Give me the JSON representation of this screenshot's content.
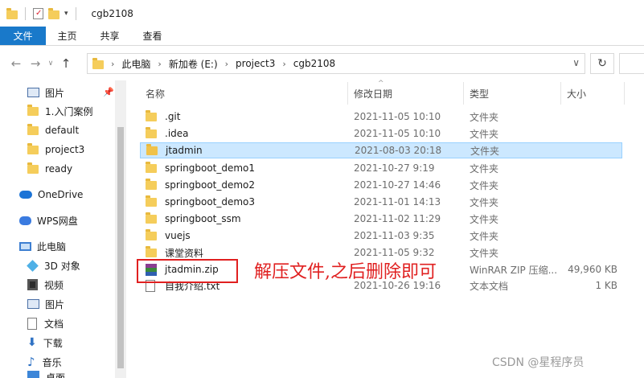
{
  "window": {
    "title": "cgb2108"
  },
  "ribbon": {
    "tabs": [
      "文件",
      "主页",
      "共享",
      "查看"
    ]
  },
  "address": {
    "crumbs": [
      "此电脑",
      "新加卷 (E:)",
      "project3",
      "cgb2108"
    ]
  },
  "nav": {
    "items": [
      {
        "label": "图片",
        "icon": "picture-icon"
      },
      {
        "label": "1.入门案例",
        "icon": "folder-icon"
      },
      {
        "label": "default",
        "icon": "folder-icon"
      },
      {
        "label": "project3",
        "icon": "folder-icon"
      },
      {
        "label": "ready",
        "icon": "folder-icon"
      },
      {
        "label": "OneDrive",
        "icon": "onedrive-icon"
      },
      {
        "label": "WPS网盘",
        "icon": "wps-cloud-icon"
      },
      {
        "label": "此电脑",
        "icon": "this-pc-icon"
      },
      {
        "label": "3D 对象",
        "icon": "3d-objects-icon"
      },
      {
        "label": "视频",
        "icon": "video-icon"
      },
      {
        "label": "图片",
        "icon": "picture-icon"
      },
      {
        "label": "文档",
        "icon": "document-icon"
      },
      {
        "label": "下载",
        "icon": "download-icon"
      },
      {
        "label": "音乐",
        "icon": "music-icon"
      },
      {
        "label": "桌面",
        "icon": "desktop-icon"
      }
    ]
  },
  "columns": {
    "name": "名称",
    "date": "修改日期",
    "type": "类型",
    "size": "大小"
  },
  "files": [
    {
      "name": ".git",
      "date": "2021-11-05 10:10",
      "type": "文件夹",
      "size": "",
      "kind": "folder"
    },
    {
      "name": ".idea",
      "date": "2021-11-05 10:10",
      "type": "文件夹",
      "size": "",
      "kind": "folder"
    },
    {
      "name": "jtadmin",
      "date": "2021-08-03 20:18",
      "type": "文件夹",
      "size": "",
      "kind": "folder"
    },
    {
      "name": "springboot_demo1",
      "date": "2021-10-27 9:19",
      "type": "文件夹",
      "size": "",
      "kind": "folder"
    },
    {
      "name": "springboot_demo2",
      "date": "2021-10-27 14:46",
      "type": "文件夹",
      "size": "",
      "kind": "folder"
    },
    {
      "name": "springboot_demo3",
      "date": "2021-11-01 14:13",
      "type": "文件夹",
      "size": "",
      "kind": "folder"
    },
    {
      "name": "springboot_ssm",
      "date": "2021-11-02 11:29",
      "type": "文件夹",
      "size": "",
      "kind": "folder"
    },
    {
      "name": "vuejs",
      "date": "2021-11-03 9:35",
      "type": "文件夹",
      "size": "",
      "kind": "folder"
    },
    {
      "name": "课堂资料",
      "date": "2021-11-05 9:32",
      "type": "文件夹",
      "size": "",
      "kind": "folder"
    },
    {
      "name": "jtadmin.zip",
      "date": "",
      "type": "WinRAR ZIP 压缩...",
      "size": "49,960 KB",
      "kind": "zip"
    },
    {
      "name": "自我介绍.txt",
      "date": "2021-10-26 19:16",
      "type": "文本文档",
      "size": "1 KB",
      "kind": "txt"
    }
  ],
  "annotation": {
    "text": "解压文件,之后删除即可"
  },
  "watermark": {
    "text": "CSDN @星程序员"
  },
  "colors": {
    "accent": "#1979ca",
    "selection": "#cce8ff",
    "annotation": "#e02020",
    "folder": "#f5cd5b"
  }
}
